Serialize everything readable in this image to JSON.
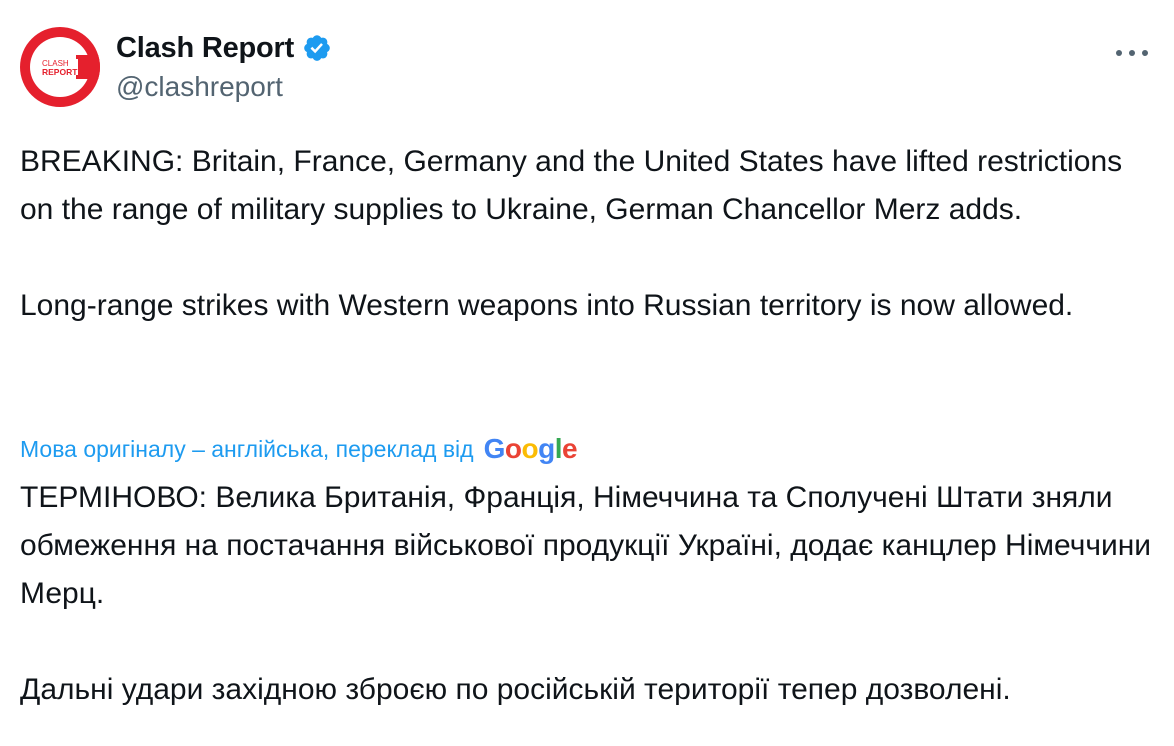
{
  "author": {
    "display_name": "Clash Report",
    "handle": "@clashreport",
    "avatar": {
      "line1": "CLASH",
      "line2": "REPORT",
      "color": "#e5202d"
    },
    "verified_icon": "verified-badge-icon",
    "verified_color": "#1d9bf0"
  },
  "menu": {
    "icon": "more-dots-icon"
  },
  "tweet": {
    "para1": "BREAKING: Britain, France, Germany and the United States have lifted restrictions on the range of military supplies to Ukraine, German Chancellor Merz adds.",
    "para2": "Long-range strikes with Western weapons into Russian territory is now allowed."
  },
  "translation": {
    "note": "Мова оригіналу – англійська, переклад від",
    "provider": "Google",
    "link_color": "#1d9bf0",
    "para1": "ТЕРМІНОВО: Велика Британія, Франція, Німеччина та Сполучені Штати зняли обмеження на постачання військової продукції Україні, додає канцлер Німеччини Мерц.",
    "para2": "Дальні удари західною зброєю по російській території тепер дозволені."
  }
}
